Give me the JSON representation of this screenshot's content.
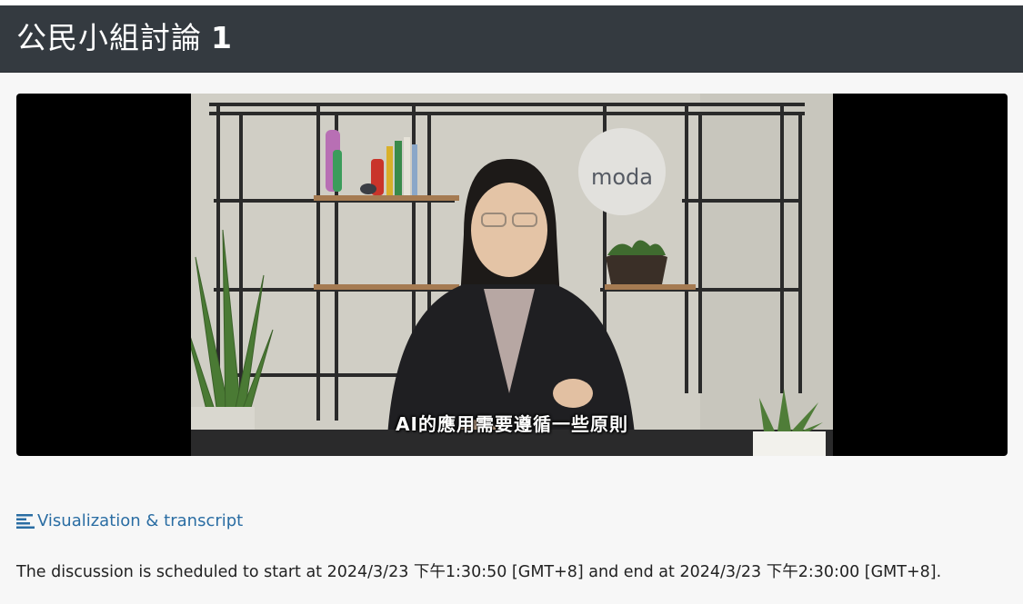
{
  "header": {
    "title": "公民小組討論",
    "number": "1"
  },
  "video": {
    "caption": "AI的應用需要遵循一些原則",
    "logo_text": "moda"
  },
  "links": {
    "visualization_label": "Visualization & transcript",
    "visualization_icon": "align-left-icon"
  },
  "schedule": {
    "text": "The discussion is scheduled to start at 2024/3/23 下午1:30:50 [GMT+8] and end at 2024/3/23 下午2:30:00 [GMT+8]."
  },
  "colors": {
    "header_bg": "#343a40",
    "link": "#2a6da3",
    "page_bg": "#f7f7f7"
  }
}
